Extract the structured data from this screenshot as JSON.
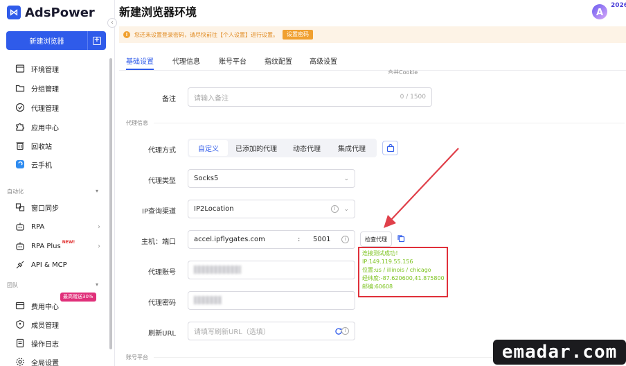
{
  "app": {
    "logo_text": "AdsPower",
    "logo_glyph": "⋈"
  },
  "sidebar": {
    "new_button": "新建浏览器",
    "items": [
      {
        "label": "环境管理",
        "icon": "window-icon"
      },
      {
        "label": "分组管理",
        "icon": "folder-icon"
      },
      {
        "label": "代理管理",
        "icon": "proxy-icon"
      },
      {
        "label": "应用中心",
        "icon": "puzzle-icon"
      },
      {
        "label": "回收站",
        "icon": "trash-icon"
      },
      {
        "label": "云手机",
        "icon": "cloud-phone-icon"
      }
    ],
    "section_automation": "自动化",
    "automation_items": [
      {
        "label": "窗口同步"
      },
      {
        "label": "RPA"
      },
      {
        "label": "RPA Plus",
        "badge": "NEW!"
      },
      {
        "label": "API & MCP"
      }
    ],
    "section_team": "团队",
    "team_items": [
      {
        "label": "费用中心",
        "promo": "最高赠送30%"
      },
      {
        "label": "成员管理"
      },
      {
        "label": "操作日志"
      },
      {
        "label": "全局设置"
      }
    ]
  },
  "header": {
    "title": "新建浏览器环境",
    "year": "2026"
  },
  "notice": {
    "text": "您还未设置登录密码，请尽快前往【个人设置】进行设置。",
    "button": "设置密码"
  },
  "tabs": [
    "基础设置",
    "代理信息",
    "账号平台",
    "指纹配置",
    "高级设置"
  ],
  "cut_text": "合并Cookie",
  "form": {
    "remark_label": "备注",
    "remark_placeholder": "请输入备注",
    "remark_count": "0 / 1500",
    "proxy_section": "代理信息",
    "proxy_mode_label": "代理方式",
    "proxy_modes": [
      "自定义",
      "已添加的代理",
      "动态代理",
      "集成代理"
    ],
    "proxy_type_label": "代理类型",
    "proxy_type_value": "Socks5",
    "ip_channel_label": "IP查询渠道",
    "ip_channel_value": "IP2Location",
    "host_label": "主机：端口",
    "host_value": "accel.ipflygates.com",
    "host_sep": ":",
    "port_value": "5001",
    "check_button": "检查代理",
    "account_label": "代理账号",
    "password_label": "代理密码",
    "refresh_label": "刷新URL",
    "refresh_placeholder": "请填写刷新URL（选填）",
    "account_platform_section": "账号平台"
  },
  "result": [
    "连接测试成功！",
    "IP:149.119.55.156",
    "位置:us / illinois / chicago",
    "经纬度:-87.620600,41.875800",
    "邮编:60608"
  ],
  "watermark": "emadar.com",
  "colors": {
    "accent": "#2f5bea",
    "success": "#7cc31e",
    "highlight": "#e0303a",
    "warning": "#f0a030"
  }
}
